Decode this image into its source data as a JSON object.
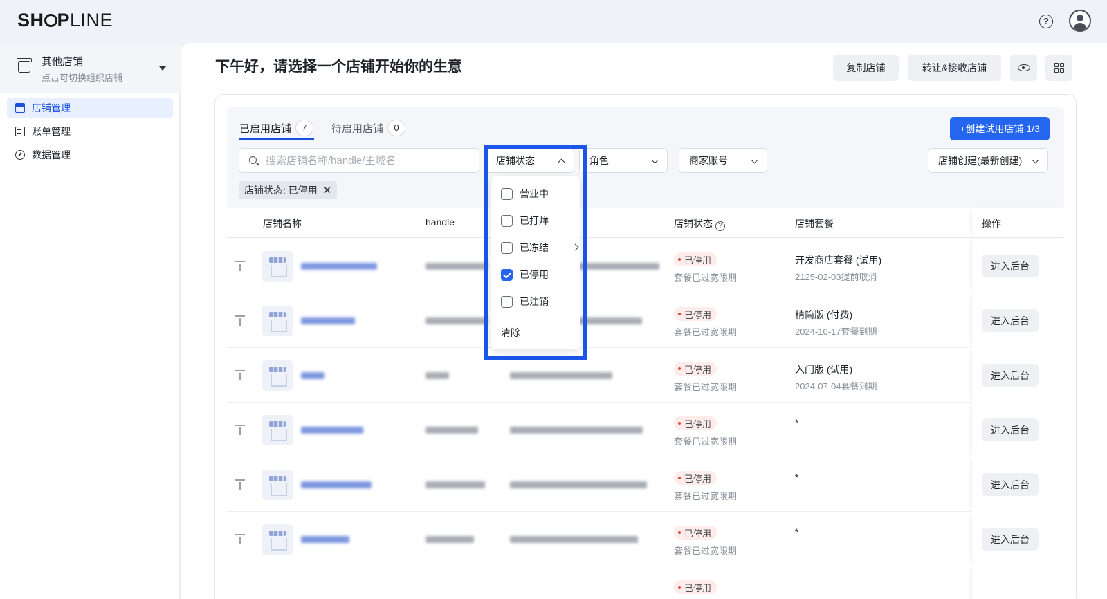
{
  "header": {
    "logo_text": "SHOPLINE",
    "help_icon": "question-circle-icon",
    "avatar_icon": "user-avatar-icon"
  },
  "sidebar": {
    "org_name": "其他店铺",
    "org_sub": "点击可切换组织店铺",
    "items": [
      {
        "label": "店铺管理",
        "icon": "store-icon",
        "active": true
      },
      {
        "label": "账单管理",
        "icon": "bill-icon",
        "active": false
      },
      {
        "label": "数据管理",
        "icon": "dashboard-icon",
        "active": false
      }
    ]
  },
  "main": {
    "greeting": "下午好，请选择一个店铺开始你的生意",
    "toolbar": {
      "copy_label": "复制店铺",
      "transfer_label": "转让&接收店铺"
    },
    "tabs": [
      {
        "label": "已启用店铺",
        "count": "7",
        "active": true
      },
      {
        "label": "待启用店铺",
        "count": "0",
        "active": false
      }
    ],
    "create_label": "+创建试用店铺 1/3",
    "search_placeholder": "搜索店铺名称/handle/主域名",
    "filters": {
      "status": "店铺状态",
      "role": "角色",
      "merchant": "商家账号",
      "sort": "店铺创建(最新创建)"
    },
    "active_filter_tag": "店铺状态: 已停用",
    "columns": {
      "name": "店铺名称",
      "handle": "handle",
      "status": "店铺状态",
      "plan": "店铺套餐",
      "action": "操作"
    },
    "rows": [
      {
        "status": "已停用",
        "status_sub": "套餐已过宽限期",
        "plan": "开发商店套餐 (试用)",
        "plan_sub": "2125-02-03提前取消",
        "action": "进入后台"
      },
      {
        "status": "已停用",
        "status_sub": "套餐已过宽限期",
        "plan": "精简版 (付费)",
        "plan_sub": "2024-10-17套餐到期",
        "action": "进入后台"
      },
      {
        "status": "已停用",
        "status_sub": "套餐已过宽限期",
        "plan": "入门版 (试用)",
        "plan_sub": "2024-07-04套餐到期",
        "action": "进入后台"
      },
      {
        "status": "已停用",
        "status_sub": "套餐已过宽限期",
        "plan": "*",
        "plan_sub": "",
        "action": "进入后台"
      },
      {
        "status": "已停用",
        "status_sub": "套餐已过宽限期",
        "plan": "*",
        "plan_sub": "",
        "action": "进入后台"
      },
      {
        "status": "已停用",
        "status_sub": "套餐已过宽限期",
        "plan": "*",
        "plan_sub": "",
        "action": "进入后台"
      },
      {
        "status": "已停用",
        "status_sub": "",
        "plan": "",
        "plan_sub": "",
        "action": ""
      }
    ]
  },
  "status_dropdown": {
    "options": [
      {
        "label": "营业中",
        "checked": false
      },
      {
        "label": "已打烊",
        "checked": false
      },
      {
        "label": "已冻结",
        "checked": false,
        "has_submenu": true
      },
      {
        "label": "已停用",
        "checked": true
      },
      {
        "label": "已注销",
        "checked": false
      }
    ],
    "clear_label": "清除"
  },
  "colors": {
    "primary": "#2466f0",
    "highlight_border": "#1a56e8",
    "status_dot": "#e5483d",
    "status_bg": "#fdecea"
  }
}
